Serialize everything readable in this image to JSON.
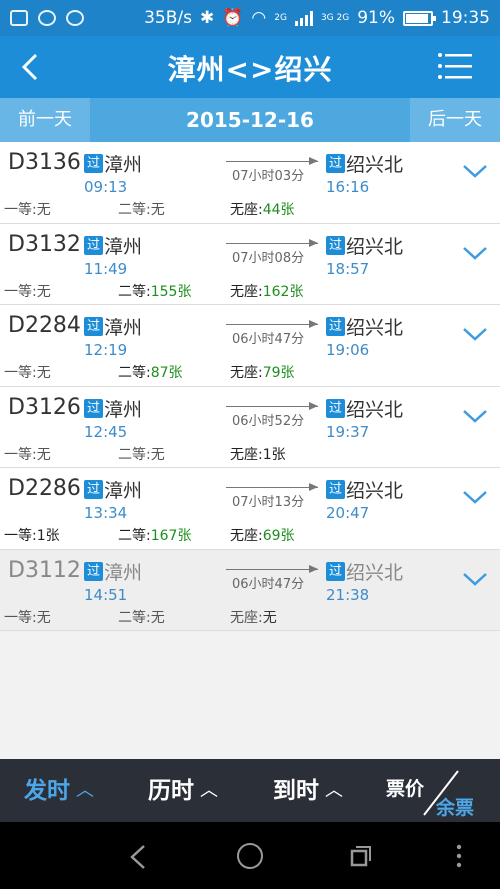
{
  "status_bar": {
    "speed": "35B/s",
    "network_a": "2G",
    "network_b": "3G 2G",
    "battery": "91%",
    "time": "19:35"
  },
  "header": {
    "title": "漳州<>绍兴"
  },
  "date_nav": {
    "prev": "前一天",
    "date": "2015-12-16",
    "next": "后一天"
  },
  "trains": [
    {
      "no": "D3136",
      "badge": "过",
      "from": "漳州",
      "dep": "09:13",
      "duration": "07小时03分",
      "to": "绍兴北",
      "arr": "16:16",
      "first_label": "一等:",
      "first": "无",
      "second_label": "二等:",
      "second": "无",
      "none_label": "无座:",
      "none": "44张"
    },
    {
      "no": "D3132",
      "badge": "过",
      "from": "漳州",
      "dep": "11:49",
      "duration": "07小时08分",
      "to": "绍兴北",
      "arr": "18:57",
      "first_label": "一等:",
      "first": "无",
      "second_label": "二等:",
      "second": "155张",
      "none_label": "无座:",
      "none": "162张"
    },
    {
      "no": "D2284",
      "badge": "过",
      "from": "漳州",
      "dep": "12:19",
      "duration": "06小时47分",
      "to": "绍兴北",
      "arr": "19:06",
      "first_label": "一等:",
      "first": "无",
      "second_label": "二等:",
      "second": "87张",
      "none_label": "无座:",
      "none": "79张"
    },
    {
      "no": "D3126",
      "badge": "过",
      "from": "漳州",
      "dep": "12:45",
      "duration": "06小时52分",
      "to": "绍兴北",
      "arr": "19:37",
      "first_label": "一等:",
      "first": "无",
      "second_label": "二等:",
      "second": "无",
      "none_label": "无座:",
      "none": "1张"
    },
    {
      "no": "D2286",
      "badge": "过",
      "from": "漳州",
      "dep": "13:34",
      "duration": "07小时13分",
      "to": "绍兴北",
      "arr": "20:47",
      "first_label": "一等:",
      "first": "1张",
      "second_label": "二等:",
      "second": "167张",
      "none_label": "无座:",
      "none": "69张"
    },
    {
      "no": "D3112",
      "badge": "过",
      "from": "漳州",
      "dep": "14:51",
      "duration": "06小时47分",
      "to": "绍兴北",
      "arr": "21:38",
      "first_label": "一等:",
      "first": "无",
      "second_label": "二等:",
      "second": "无",
      "none_label": "无座:",
      "none": "无"
    }
  ],
  "sort_bar": {
    "depart": "发时",
    "duration": "历时",
    "arrive": "到时",
    "price": "票价",
    "remain": "余票",
    "arrow": "^"
  },
  "colors": {
    "primary": "#1E8DD8",
    "available": "#1D8E1D",
    "time_blue": "#3D8CC9",
    "bar_dark": "#2B3038",
    "active_sort": "#4DA6E8"
  }
}
